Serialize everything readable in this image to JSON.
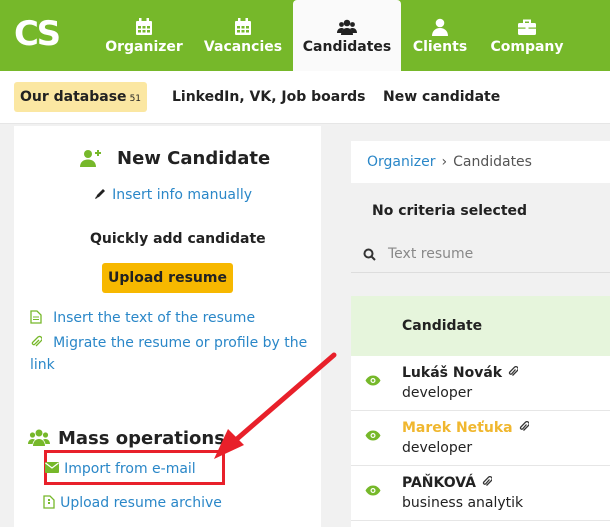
{
  "brand": {
    "logo_text": "CS",
    "accent": "#76b82a"
  },
  "nav": {
    "tabs": [
      {
        "label": "Organizer",
        "icon": "calendar-icon"
      },
      {
        "label": "Vacancies",
        "icon": "calendar-icon"
      },
      {
        "label": "Candidates",
        "icon": "users-icon",
        "active": true
      },
      {
        "label": "Clients",
        "icon": "user-icon"
      },
      {
        "label": "Company",
        "icon": "briefcase-icon"
      }
    ]
  },
  "subnav": {
    "our_database": "Our database",
    "our_database_count": "51",
    "job_boards": "LinkedIn, VK, Job boards",
    "new_candidate": "New candidate"
  },
  "left": {
    "title": "New Candidate",
    "insert_manual": "Insert info manually",
    "quick_add": "Quickly add candidate",
    "upload_resume": "Upload resume",
    "insert_text": "Insert the text of the resume",
    "migrate_line1": "Migrate the resume or profile by the",
    "migrate_line2": "link",
    "mass_title": "Mass operations",
    "import_email": "Import from e-mail",
    "upload_archive": "Upload resume archive",
    "highlight_color": "#e8202a"
  },
  "right": {
    "breadcrumb": {
      "organizer": "Organizer",
      "current": "Candidates"
    },
    "no_criteria": "No criteria selected",
    "search_placeholder": "Text resume",
    "column_candidate": "Candidate",
    "rows": [
      {
        "name": "Lukáš Novák",
        "role": "developer",
        "name_color": "#222"
      },
      {
        "name": "Marek Neťuka",
        "role": "developer",
        "name_color": "#f0b72f"
      },
      {
        "name": "PAŇKOVÁ",
        "role": "business analytik",
        "name_color": "#222"
      }
    ]
  }
}
